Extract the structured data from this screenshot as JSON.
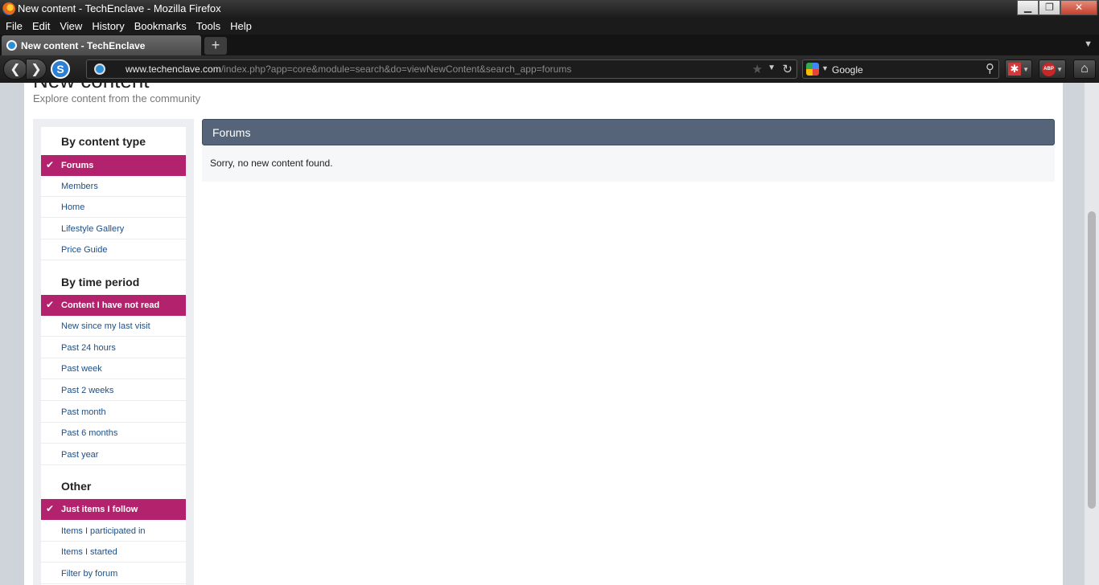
{
  "window": {
    "title": "New content - TechEnclave - Mozilla Firefox",
    "minimize": "▁",
    "maximize": "❐",
    "close": "✕"
  },
  "menu": [
    "File",
    "Edit",
    "View",
    "History",
    "Bookmarks",
    "Tools",
    "Help"
  ],
  "tab": {
    "title": "New content - TechEnclave",
    "new_tab_label": "+"
  },
  "toolbar": {
    "url_domain": "www.techenclave.com",
    "url_path": "/index.php?app=core&module=search&do=viewNewContent&search_app=forums",
    "search_placeholder": "Google",
    "icons": [
      "back-icon",
      "forward-icon",
      "s-icon",
      "site-identity-icon",
      "bookmark-star-icon",
      "reload-icon",
      "google-icon",
      "search-icon",
      "addon-icon",
      "adblock-plus-icon",
      "home-icon"
    ]
  },
  "page": {
    "title": "New content",
    "description": "Explore content from the community"
  },
  "sidebar": {
    "sections": [
      {
        "heading": "By content type",
        "items": [
          {
            "label": "Forums",
            "active": true
          },
          {
            "label": "Members",
            "active": false
          },
          {
            "label": "Home",
            "active": false
          },
          {
            "label": "Lifestyle Gallery",
            "active": false
          },
          {
            "label": "Price Guide",
            "active": false
          }
        ]
      },
      {
        "heading": "By time period",
        "items": [
          {
            "label": "Content I have not read",
            "active": true
          },
          {
            "label": "New since my last visit",
            "active": false
          },
          {
            "label": "Past 24 hours",
            "active": false
          },
          {
            "label": "Past week",
            "active": false
          },
          {
            "label": "Past 2 weeks",
            "active": false
          },
          {
            "label": "Past month",
            "active": false
          },
          {
            "label": "Past 6 months",
            "active": false
          },
          {
            "label": "Past year",
            "active": false
          }
        ]
      },
      {
        "heading": "Other",
        "items": [
          {
            "label": "Just items I follow",
            "active": true
          },
          {
            "label": "Items I participated in",
            "active": false
          },
          {
            "label": "Items I started",
            "active": false
          },
          {
            "label": "Filter by forum",
            "active": false
          }
        ]
      }
    ]
  },
  "main": {
    "section_title": "Forums",
    "message": "Sorry, no new content found."
  },
  "colors": {
    "accent_active": "#b3226d",
    "header_bar": "#556479",
    "link": "#1d4f86",
    "annotation_arrow": "#e32a1c"
  }
}
